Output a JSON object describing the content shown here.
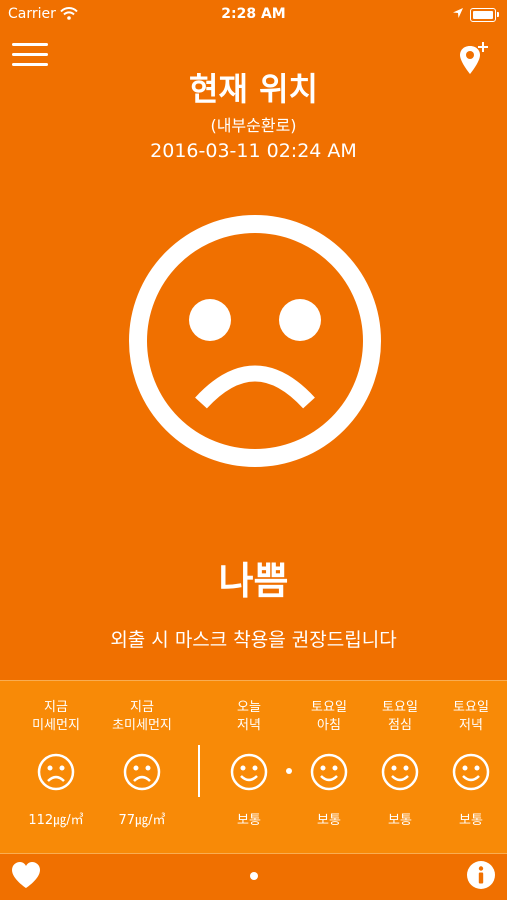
{
  "status_bar": {
    "carrier": "Carrier",
    "time": "2:28 AM"
  },
  "header": {
    "title": "현재 위치",
    "subtitle": "(내부순환로)",
    "timestamp": "2016-03-11 02:24 AM"
  },
  "main": {
    "status_label": "나쁨",
    "advice": "외출 시 마스크 착용을 권장드립니다",
    "face": "sad-face-icon"
  },
  "forecast": [
    {
      "line1": "지금",
      "line2": "미세먼지",
      "face": "sad",
      "value": "112㎍/㎥"
    },
    {
      "line1": "지금",
      "line2": "초미세먼지",
      "face": "sad",
      "value": "77㎍/㎥"
    },
    {
      "line1": "오늘",
      "line2": "저녁",
      "face": "happy",
      "value": "보통"
    },
    {
      "line1": "토요일",
      "line2": "아침",
      "face": "happy",
      "value": "보통"
    },
    {
      "line1": "토요일",
      "line2": "점심",
      "face": "happy",
      "value": "보통"
    },
    {
      "line1": "토요일",
      "line2": "저녁",
      "face": "happy",
      "value": "보통"
    }
  ],
  "colors": {
    "background": "#f07000",
    "forecast_bg": "#f88a07",
    "foreground": "#ffffff"
  },
  "icons": {
    "menu": "hamburger-menu-icon",
    "add_location": "location-plus-icon",
    "favorite": "heart-icon",
    "info": "info-icon"
  }
}
